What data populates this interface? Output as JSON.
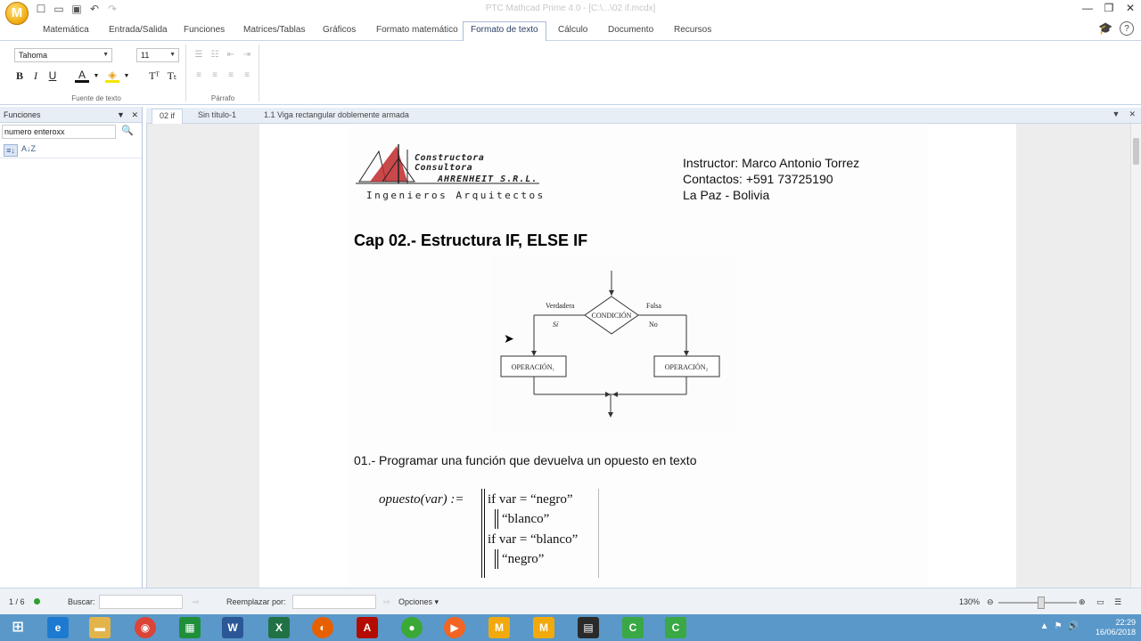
{
  "window": {
    "app_logo": "M",
    "title": "PTC Mathcad Prime 4.0 - [C:\\...\\02 if.mcdx]",
    "controls": [
      "—",
      "❐",
      "✕"
    ]
  },
  "ribbon": {
    "tabs": [
      "Matemática",
      "Entrada/Salida",
      "Funciones",
      "Matrices/Tablas",
      "Gráficos",
      "Formato matemático",
      "Formato de texto",
      "Cálculo",
      "Documento",
      "Recursos"
    ],
    "active_tab": "Formato de texto",
    "font_family": "Tahoma",
    "font_size": "11",
    "bold": "B",
    "italic": "I",
    "underline": "U",
    "font_color": "A",
    "highlight": "◈",
    "superscript": "Tᵀ",
    "subscript": "Tₜ",
    "group_font_label": "Fuente de texto",
    "group_paragraph_label": "Párrafo"
  },
  "left_panel": {
    "title": "Funciones",
    "search_value": "numero enteroxx",
    "sort_icons": [
      "≡↓",
      "A↓Z"
    ]
  },
  "doc_tabs": [
    "02 if",
    "Sin título-1",
    "1.1 Viga rectangular doblemente armada"
  ],
  "document": {
    "logo_line1": "Constructora Consultora",
    "logo_line2": "AHRENHEIT S.R.L.",
    "logo_line3": "Ingenieros Arquitectos",
    "instructor": "Instructor: Marco Antonio Torrez",
    "contacts": "Contactos: +591 73725190",
    "location": "La Paz - Bolivia",
    "chapter_title": "Cap 02.- Estructura IF, ELSE IF",
    "flowchart": {
      "condition": "CONDICIÓN",
      "true_label": "Verdadera",
      "false_label": "Falsa",
      "yes": "Sí",
      "no": "No",
      "op1": "OPERACIÓN₁",
      "op2": "OPERACIÓN₂"
    },
    "exercise": "01.- Programar una función que devuelva un opuesto en texto",
    "math": {
      "lhs": "opuesto(var) :=",
      "line1": "if var = “negro”",
      "line2": "“blanco”",
      "line3": "if var = “blanco”",
      "line4": "“negro”"
    }
  },
  "status_bar": {
    "page": "1 / 6",
    "find_label": "Buscar:",
    "replace_label": "Reemplazar por:",
    "options_label": "Opciones",
    "zoom": "130%"
  },
  "taskbar": {
    "time": "22:29",
    "date": "16/06/2018"
  },
  "colors": {
    "ribbon_border": "#c7d4e6",
    "taskbar": "#5a98c9",
    "logo_red": "#c0282a"
  }
}
